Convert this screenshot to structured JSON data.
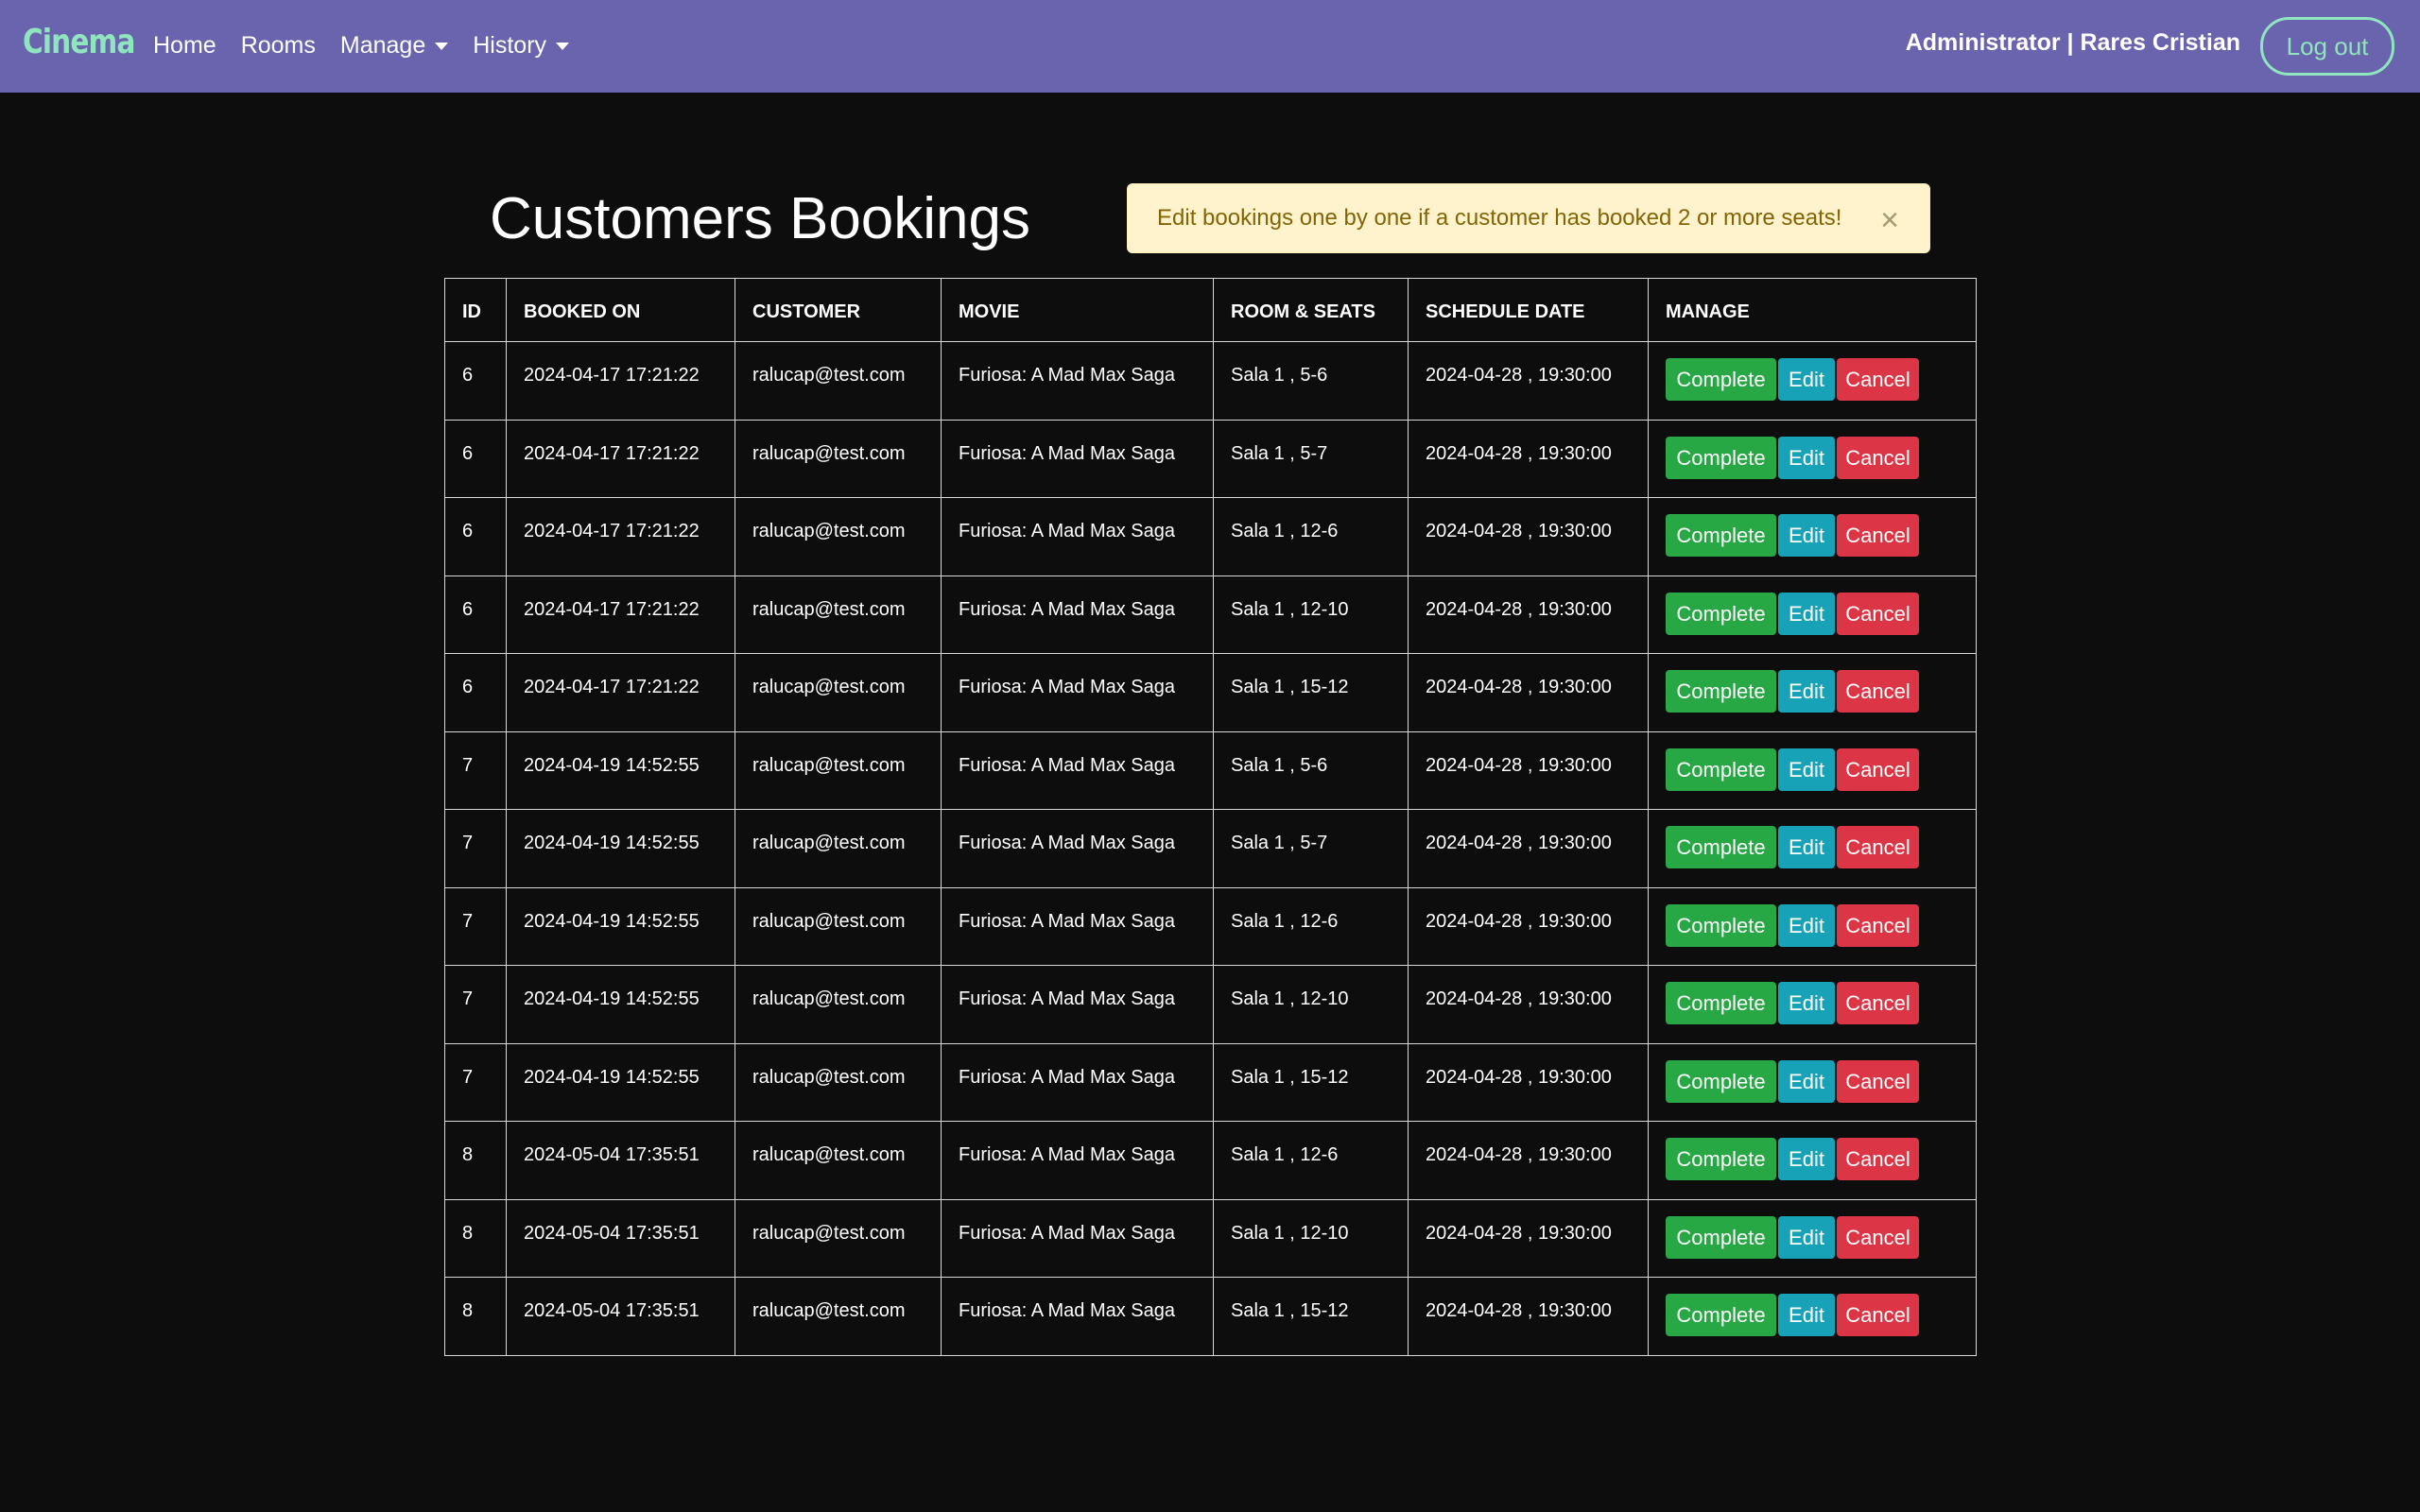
{
  "navbar": {
    "brand": "Cinema",
    "links": [
      {
        "label": "Home",
        "dropdown": false
      },
      {
        "label": "Rooms",
        "dropdown": false
      },
      {
        "label": "Manage",
        "dropdown": true
      },
      {
        "label": "History",
        "dropdown": true
      }
    ],
    "user": "Administrator | Rares Cristian",
    "logout_label": "Log out"
  },
  "page": {
    "title": "Customers Bookings",
    "alert": "Edit bookings one by one if a customer has booked 2 or more seats!",
    "alert_close": "×"
  },
  "table": {
    "headers": [
      "ID",
      "BOOKED ON",
      "CUSTOMER",
      "MOVIE",
      "ROOM & SEATS",
      "SCHEDULE DATE",
      "MANAGE"
    ],
    "action_labels": {
      "complete": "Complete",
      "edit": "Edit",
      "cancel": "Cancel"
    },
    "rows": [
      {
        "id": "6",
        "booked_on": "2024-04-17 17:21:22",
        "customer": "ralucap@test.com",
        "movie": "Furiosa: A Mad Max Saga",
        "room_seats": "Sala 1 , 5-6",
        "schedule": "2024-04-28 , 19:30:00"
      },
      {
        "id": "6",
        "booked_on": "2024-04-17 17:21:22",
        "customer": "ralucap@test.com",
        "movie": "Furiosa: A Mad Max Saga",
        "room_seats": "Sala 1 , 5-7",
        "schedule": "2024-04-28 , 19:30:00"
      },
      {
        "id": "6",
        "booked_on": "2024-04-17 17:21:22",
        "customer": "ralucap@test.com",
        "movie": "Furiosa: A Mad Max Saga",
        "room_seats": "Sala 1 , 12-6",
        "schedule": "2024-04-28 , 19:30:00"
      },
      {
        "id": "6",
        "booked_on": "2024-04-17 17:21:22",
        "customer": "ralucap@test.com",
        "movie": "Furiosa: A Mad Max Saga",
        "room_seats": "Sala 1 , 12-10",
        "schedule": "2024-04-28 , 19:30:00"
      },
      {
        "id": "6",
        "booked_on": "2024-04-17 17:21:22",
        "customer": "ralucap@test.com",
        "movie": "Furiosa: A Mad Max Saga",
        "room_seats": "Sala 1 , 15-12",
        "schedule": "2024-04-28 , 19:30:00"
      },
      {
        "id": "7",
        "booked_on": "2024-04-19 14:52:55",
        "customer": "ralucap@test.com",
        "movie": "Furiosa: A Mad Max Saga",
        "room_seats": "Sala 1 , 5-6",
        "schedule": "2024-04-28 , 19:30:00"
      },
      {
        "id": "7",
        "booked_on": "2024-04-19 14:52:55",
        "customer": "ralucap@test.com",
        "movie": "Furiosa: A Mad Max Saga",
        "room_seats": "Sala 1 , 5-7",
        "schedule": "2024-04-28 , 19:30:00"
      },
      {
        "id": "7",
        "booked_on": "2024-04-19 14:52:55",
        "customer": "ralucap@test.com",
        "movie": "Furiosa: A Mad Max Saga",
        "room_seats": "Sala 1 , 12-6",
        "schedule": "2024-04-28 , 19:30:00"
      },
      {
        "id": "7",
        "booked_on": "2024-04-19 14:52:55",
        "customer": "ralucap@test.com",
        "movie": "Furiosa: A Mad Max Saga",
        "room_seats": "Sala 1 , 12-10",
        "schedule": "2024-04-28 , 19:30:00"
      },
      {
        "id": "7",
        "booked_on": "2024-04-19 14:52:55",
        "customer": "ralucap@test.com",
        "movie": "Furiosa: A Mad Max Saga",
        "room_seats": "Sala 1 , 15-12",
        "schedule": "2024-04-28 , 19:30:00"
      },
      {
        "id": "8",
        "booked_on": "2024-05-04 17:35:51",
        "customer": "ralucap@test.com",
        "movie": "Furiosa: A Mad Max Saga",
        "room_seats": "Sala 1 , 12-6",
        "schedule": "2024-04-28 , 19:30:00"
      },
      {
        "id": "8",
        "booked_on": "2024-05-04 17:35:51",
        "customer": "ralucap@test.com",
        "movie": "Furiosa: A Mad Max Saga",
        "room_seats": "Sala 1 , 12-10",
        "schedule": "2024-04-28 , 19:30:00"
      },
      {
        "id": "8",
        "booked_on": "2024-05-04 17:35:51",
        "customer": "ralucap@test.com",
        "movie": "Furiosa: A Mad Max Saga",
        "room_seats": "Sala 1 , 15-12",
        "schedule": "2024-04-28 , 19:30:00"
      }
    ]
  },
  "colors": {
    "navbar_bg": "#6a63ad",
    "brand": "#8fe6be",
    "page_bg": "#0d0d0d",
    "complete": "#28a745",
    "edit": "#17a2b8",
    "cancel": "#dc3545",
    "alert_bg": "#fff3cd",
    "alert_text": "#856404"
  }
}
